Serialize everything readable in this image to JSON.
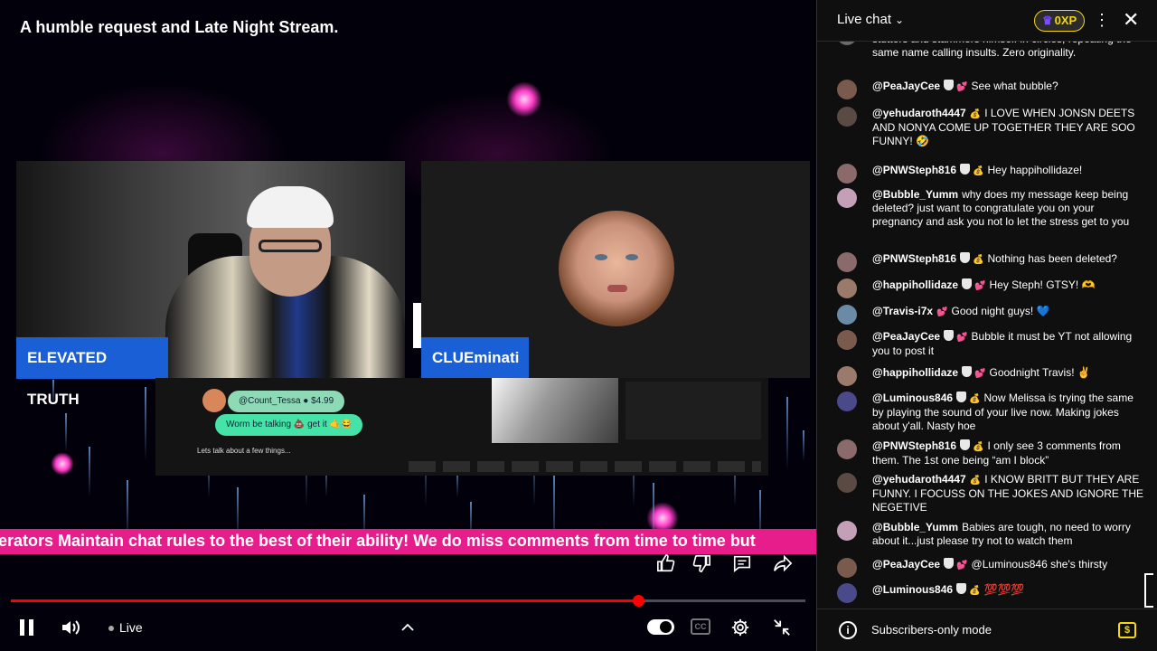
{
  "video": {
    "title": "A humble request and Late Night Stream.",
    "ticker": "erators Maintain chat rules to the best of their ability! We do miss comments from time to time but",
    "cams": [
      {
        "name": "ELEVATED TRUTH"
      },
      {
        "name": "CLUEminati"
      }
    ],
    "screen_share": {
      "bubble1": "@Count_Tessa  ●  $4.99",
      "bubble2": "Worm be talking 💩 get it 🤙😂",
      "caption": "Lets talk about a few things..."
    },
    "progress_fraction": 0.79,
    "live_label": "Live"
  },
  "player_icons": {
    "like": "thumb-up-icon",
    "dislike": "thumb-down-icon",
    "comment": "comment-icon",
    "share": "share-icon",
    "pause": "pause-icon",
    "volume": "volume-icon",
    "settings": "gear-icon",
    "exit_fullscreen": "exit-fullscreen-icon"
  },
  "chat": {
    "header": {
      "title": "Live chat",
      "xp": "0XP"
    },
    "messages": [
      {
        "author": "",
        "mod": false,
        "member": "",
        "text": "stutters and stammers himself in circles, repeating the same name calling insults. Zero originality."
      },
      {
        "author": "@PeaJayCee",
        "mod": true,
        "member": "💕",
        "text": "See what bubble?"
      },
      {
        "author": "@yehudaroth4447",
        "mod": false,
        "member": "💰",
        "text": "I LOVE WHEN JONSN DEETS AND NONYA COME UP TOGETHER THEY ARE SOO FUNNY! 🤣"
      },
      {
        "author": "@PNWSteph816",
        "mod": true,
        "member": "💰",
        "text": "Hey happihollidaze!"
      },
      {
        "author": "@Bubble_Yumm",
        "mod": false,
        "member": "",
        "text": "why does my message keep being deleted? just want to congratulate you on your pregnancy and ask you not lo let the stress get to you"
      },
      {
        "author": "@PNWSteph816",
        "mod": true,
        "member": "💰",
        "text": "Nothing has been deleted?"
      },
      {
        "author": "@happihollidaze",
        "mod": true,
        "member": "💕",
        "text": "Hey Steph! GTSY! 🫶"
      },
      {
        "author": "@Travis-i7x",
        "mod": false,
        "member": "💕",
        "text": "Good night guys! 💙"
      },
      {
        "author": "@PeaJayCee",
        "mod": true,
        "member": "💕",
        "text": "Bubble it must be YT not allowing you to post it"
      },
      {
        "author": "@happihollidaze",
        "mod": true,
        "member": "💕",
        "text": "Goodnight Travis! ✌️"
      },
      {
        "author": "@Luminous846",
        "mod": true,
        "member": "💰",
        "text": "Now Melissa is trying the same by playing the sound of your live now. Making jokes about y'all. Nasty hoe"
      },
      {
        "author": "@PNWSteph816",
        "mod": true,
        "member": "💰",
        "text": "I only see 3 comments from them. The 1st one being “am I block”"
      },
      {
        "author": "@yehudaroth4447",
        "mod": false,
        "member": "💰",
        "text": "I KNOW BRITT BUT THEY ARE FUNNY. I FOCUSS ON THE JOKES AND IGNORE THE NEGETIVE"
      },
      {
        "author": "@Bubble_Yumm",
        "mod": false,
        "member": "",
        "text": "Babies are tough, no need to worry about it...just please try not to watch them"
      },
      {
        "author": "@PeaJayCee",
        "mod": true,
        "member": "💕",
        "text": "@Luminous846 she's thirsty"
      },
      {
        "author": "@Luminous846",
        "mod": true,
        "member": "💰",
        "text": "💯💯💯"
      }
    ],
    "footer": {
      "mode": "Subscribers-only mode"
    }
  },
  "colors": {
    "ticker": "#e81d8c",
    "name_tag": "#1a5fd6",
    "progress": "#ff0000",
    "xp_gold": "#f7d60a"
  }
}
